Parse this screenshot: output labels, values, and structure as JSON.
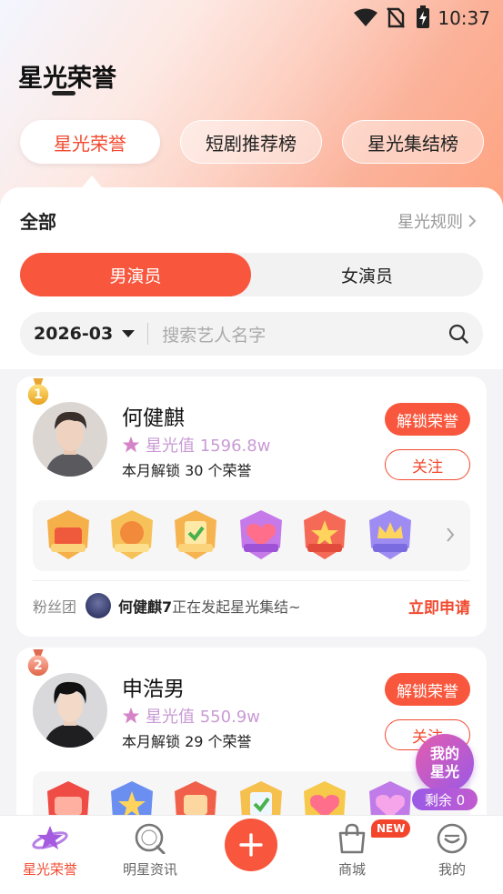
{
  "status": {
    "time": "10:37"
  },
  "header": {
    "title": "星光荣誉"
  },
  "tabs": [
    {
      "label": "星光荣誉",
      "active": true
    },
    {
      "label": "短剧推荐榜",
      "active": false
    },
    {
      "label": "星光集结榜",
      "active": false
    }
  ],
  "filter": {
    "all_label": "全部",
    "rules_label": "星光规则",
    "gender": {
      "male": "男演员",
      "female": "女演员"
    },
    "month": "2026-03",
    "search_placeholder": "搜索艺人名字"
  },
  "artists": [
    {
      "rank": "1",
      "name": "何健麒",
      "star_value": "星光值 1596.8w",
      "monthly_unlock": "本月解锁 30 个荣誉",
      "unlock_button": "解锁荣誉",
      "follow_button": "关注",
      "fan_label": "粉丝团",
      "fan_name": "何健麒7",
      "fan_text": "正在发起星光集结~",
      "apply_label": "立即申请"
    },
    {
      "rank": "2",
      "name": "申浩男",
      "star_value": "星光值 550.9w",
      "monthly_unlock": "本月解锁 29 个荣誉",
      "unlock_button": "解锁荣誉",
      "follow_button": "关注"
    }
  ],
  "floating": {
    "line1": "我的",
    "line2": "星光",
    "remaining": "剩余 0"
  },
  "bottom_nav": [
    {
      "label": "星光荣誉",
      "icon": "planet-star-icon",
      "active": true
    },
    {
      "label": "明星资讯",
      "icon": "news-search-icon",
      "active": false
    },
    {
      "label": "",
      "icon": "plus-icon",
      "active": false
    },
    {
      "label": "商城",
      "icon": "shopping-bag-icon",
      "active": false,
      "badge": "NEW"
    },
    {
      "label": "我的",
      "icon": "smiley-face-icon",
      "active": false
    }
  ],
  "colors": {
    "accent": "#f8573d",
    "accent_text": "#f24a30",
    "star_purple": "#c99bd4",
    "float_purple": "#9a5ae6"
  }
}
